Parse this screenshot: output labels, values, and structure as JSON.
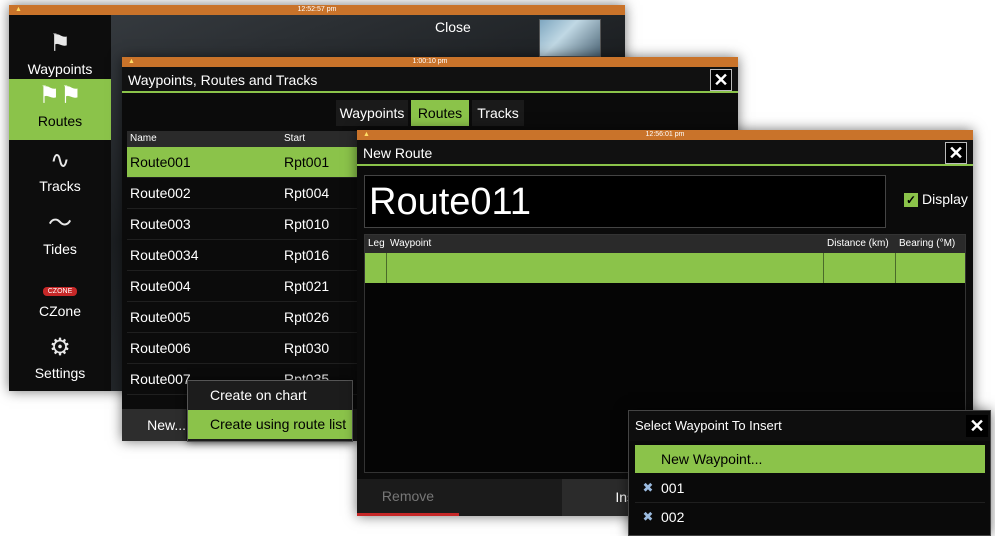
{
  "panel1": {
    "clock": "12:52:57 pm",
    "close_label": "Close",
    "sidebar": [
      {
        "label": "Waypoints",
        "icon": "flag-icon"
      },
      {
        "label": "Routes",
        "icon": "routes-icon"
      },
      {
        "label": "Tracks",
        "icon": "tracks-icon"
      },
      {
        "label": "Tides",
        "icon": "tides-icon"
      },
      {
        "label": "CZone",
        "icon": "czone-icon",
        "logo_text": "CZONE"
      },
      {
        "label": "Settings",
        "icon": "gear-icon"
      }
    ]
  },
  "panel2": {
    "clock": "1:00:10 pm",
    "title": "Waypoints, Routes and Tracks",
    "tabs": [
      "Waypoints",
      "Routes",
      "Tracks"
    ],
    "columns": [
      "Name",
      "Start"
    ],
    "rows": [
      [
        "Route001",
        "Rpt001"
      ],
      [
        "Route002",
        "Rpt004"
      ],
      [
        "Route003",
        "Rpt010"
      ],
      [
        "Route0034",
        "Rpt016"
      ],
      [
        "Route004",
        "Rpt021"
      ],
      [
        "Route005",
        "Rpt026"
      ],
      [
        "Route006",
        "Rpt030"
      ],
      [
        "Route007",
        "Rpt035"
      ]
    ],
    "new_label": "New...",
    "popup": [
      "Create on chart",
      "Create using route list"
    ]
  },
  "panel3": {
    "clock": "12:56:01 pm",
    "title": "New Route",
    "route_name": "Route011",
    "display_label": "Display",
    "columns": [
      "Leg",
      "Waypoint",
      "Distance (km)",
      "Bearing (°M)"
    ],
    "remove_label": "Remove",
    "insert_label": "Insert..."
  },
  "panel4": {
    "title": "Select Waypoint To Insert",
    "rows": [
      {
        "label": "New Waypoint...",
        "icon": ""
      },
      {
        "label": "001",
        "icon": "waypoint-icon"
      },
      {
        "label": "002",
        "icon": "waypoint-icon"
      }
    ]
  }
}
